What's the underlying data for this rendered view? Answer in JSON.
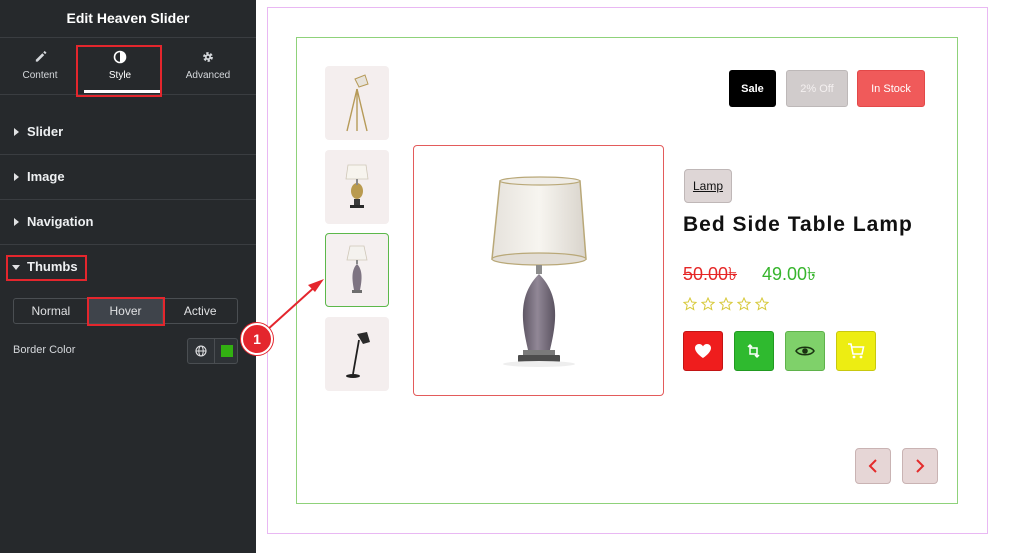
{
  "sidebar": {
    "title": "Edit Heaven Slider",
    "tabs": [
      {
        "label": "Content",
        "icon": "pencil-icon"
      },
      {
        "label": "Style",
        "icon": "half-circle-icon"
      },
      {
        "label": "Advanced",
        "icon": "gear-icon"
      }
    ],
    "active_tab": "Style",
    "sections": [
      {
        "label": "Slider",
        "open": false
      },
      {
        "label": "Image",
        "open": false
      },
      {
        "label": "Navigation",
        "open": false
      },
      {
        "label": "Thumbs",
        "open": true
      }
    ],
    "states": [
      {
        "label": "Normal"
      },
      {
        "label": "Hover"
      },
      {
        "label": "Active"
      }
    ],
    "active_state": "Hover",
    "border_color_label": "Border Color",
    "border_color_value": "#32b011"
  },
  "product": {
    "badges": [
      {
        "label": "Sale"
      },
      {
        "label": "2% Off"
      },
      {
        "label": "In Stock"
      }
    ],
    "category": "Lamp",
    "title": "Bed Side Table Lamp",
    "old_price": "50.00৳",
    "new_price": "49.00৳",
    "rating": 0,
    "rating_max": 5,
    "actions": [
      "heart-icon",
      "compare-icon",
      "eye-icon",
      "cart-icon"
    ],
    "thumbnails": [
      "floor-tripod-lamp",
      "table-lamp-gold",
      "bedside-table-lamp",
      "desk-lamp-black"
    ],
    "active_thumbnail": 3
  },
  "annotation": {
    "number": "1"
  },
  "colors": {
    "panel_bg": "#26292c",
    "highlight": "#e4262d",
    "inner_border": "#8fd27a",
    "outer_border": "#e9b8f3"
  }
}
